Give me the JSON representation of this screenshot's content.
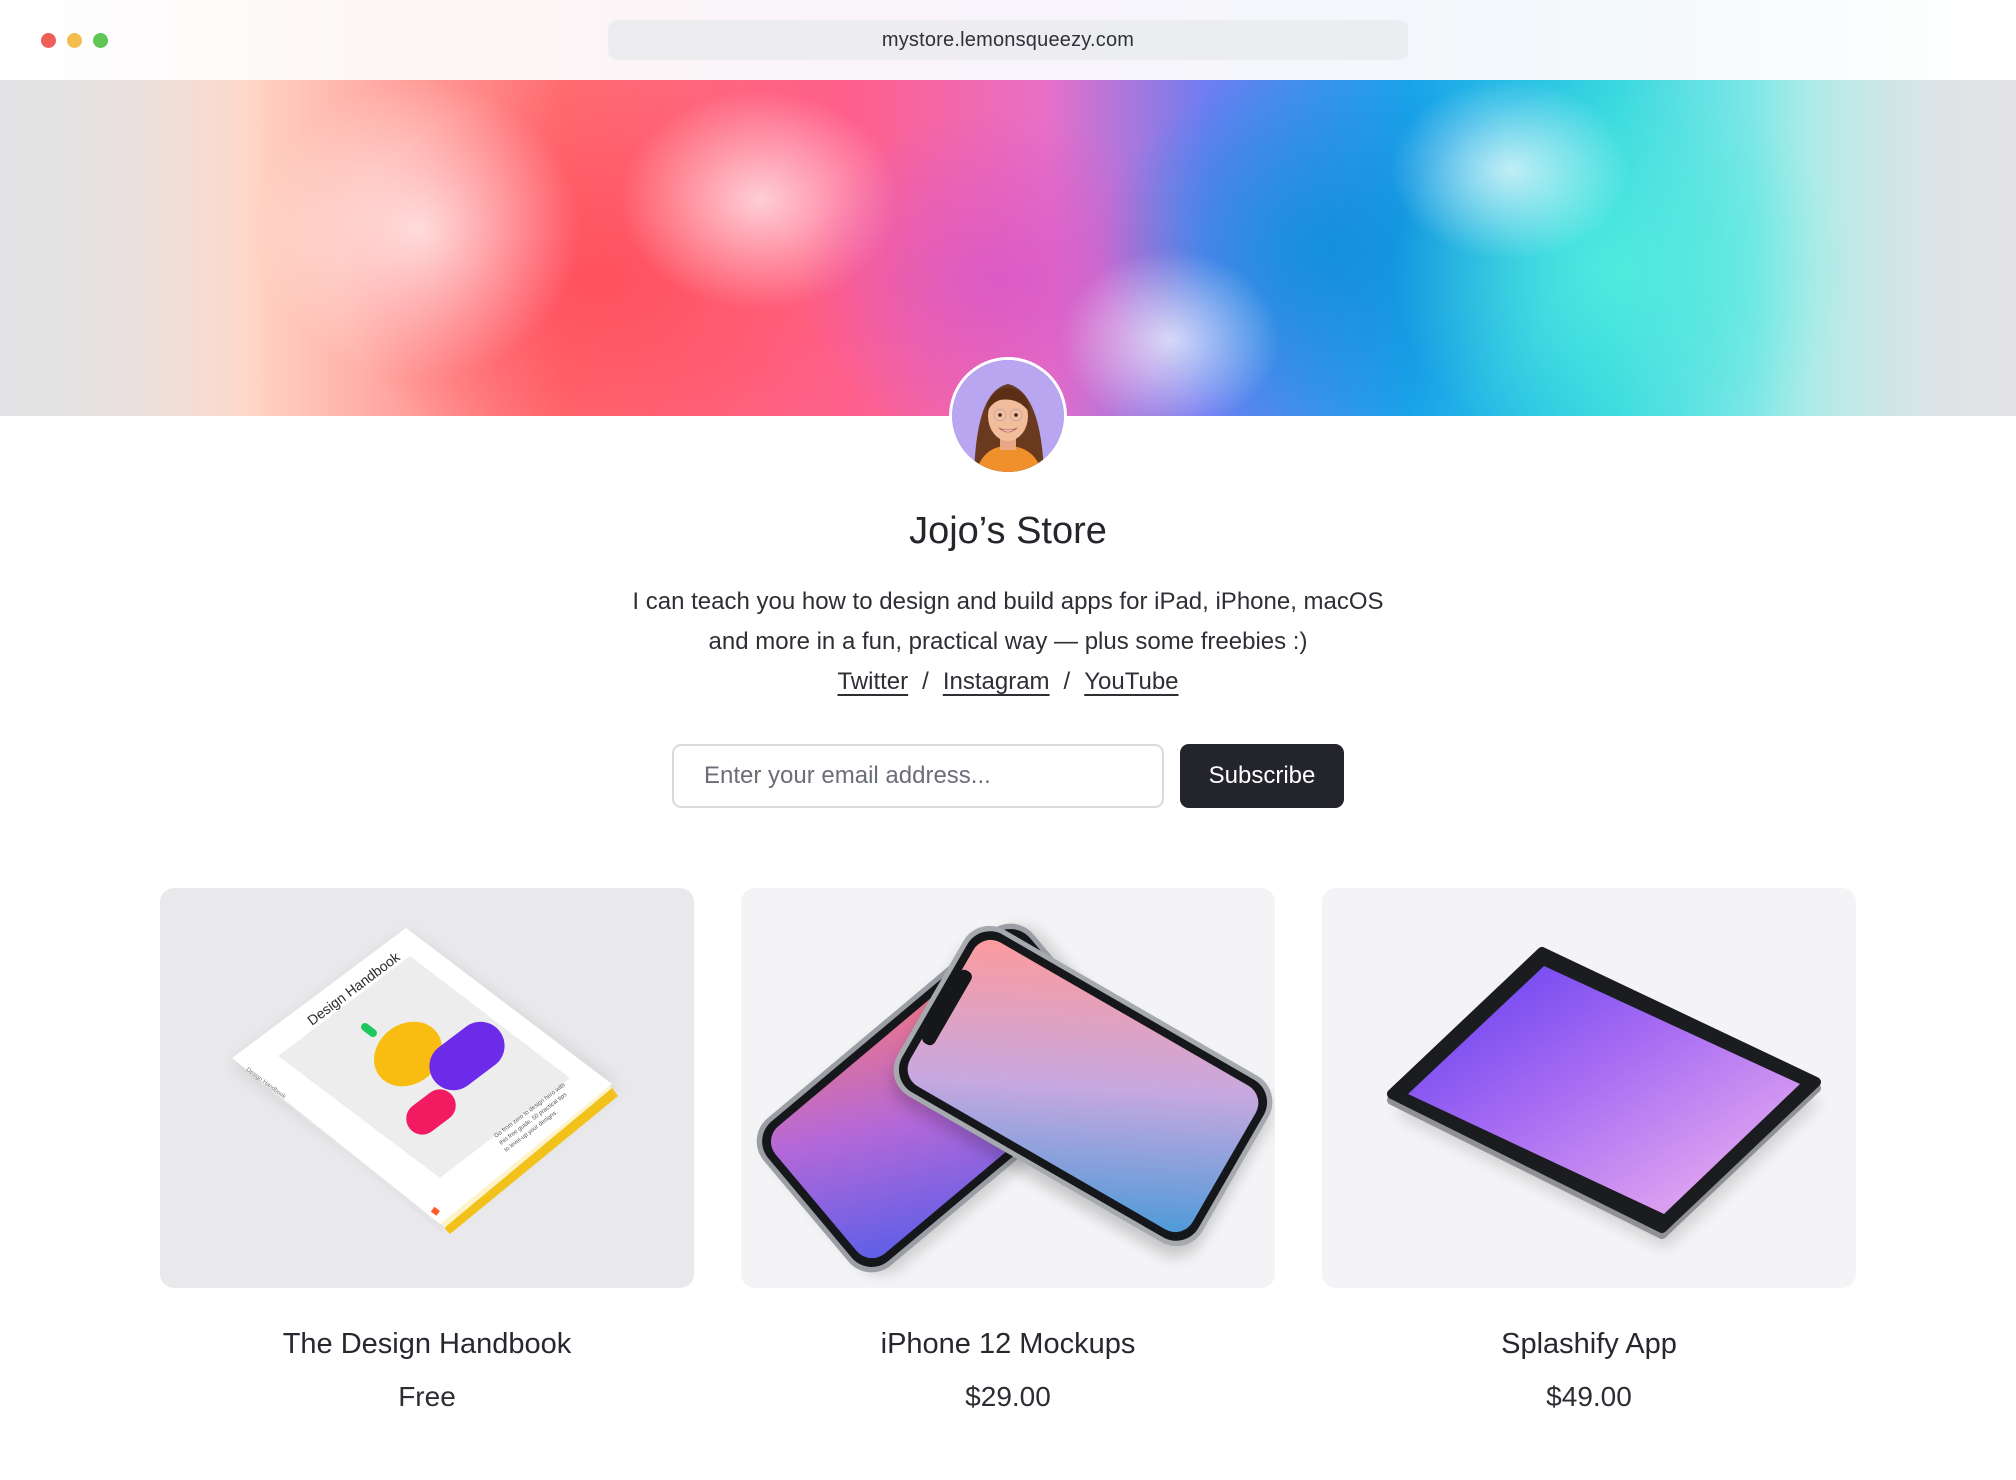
{
  "browser": {
    "url": "mystore.lemonsqueezy.com"
  },
  "store": {
    "title": "Jojo’s Store",
    "bio_line1": "I can teach you how to design and build apps for iPad, iPhone, macOS",
    "bio_line2": "and more in a fun, practical way — plus some freebies :)",
    "links": [
      "Twitter",
      "Instagram",
      "YouTube"
    ],
    "link_separator": "/"
  },
  "subscribe": {
    "placeholder": "Enter your email address...",
    "button_label": "Subscribe"
  },
  "products": [
    {
      "name": "The Design Handbook",
      "price": "Free",
      "image_text": {
        "cover_title": "Design Handbook",
        "spine": "Design Handbook",
        "blurb_lines": [
          "Go from zero to design hero with",
          "this free guide, 50 practical tips",
          "to level-up your designs."
        ]
      }
    },
    {
      "name": "iPhone 12 Mockups",
      "price": "$29.00"
    },
    {
      "name": "Splashify App",
      "price": "$49.00"
    }
  ],
  "colors": {
    "button_bg": "#23242c",
    "hero_red": "#ff5d6c",
    "hero_pink": "#ef5fb4",
    "hero_blue": "#1ea6e6",
    "hero_teal": "#3fe0da",
    "tablet_purple": "#7a55f4"
  }
}
